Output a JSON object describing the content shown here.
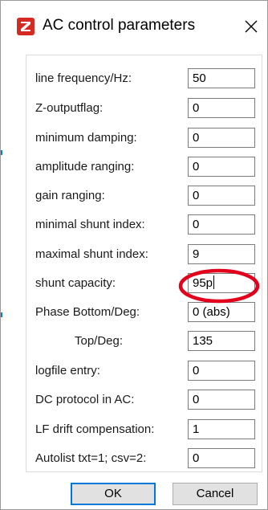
{
  "window": {
    "title": "AC control parameters",
    "accent_color": "#0078d7",
    "icon": "app-z-icon",
    "close_icon": "close-icon"
  },
  "fields": [
    {
      "label": "line frequency/Hz:",
      "value": "50"
    },
    {
      "label": "Z-outputflag:",
      "value": "0"
    },
    {
      "label": "minimum damping:",
      "value": "0"
    },
    {
      "label": "amplitude ranging:",
      "value": "0"
    },
    {
      "label": "gain ranging:",
      "value": "0"
    },
    {
      "label": "minimal shunt index:",
      "value": "0"
    },
    {
      "label": "maximal shunt index:",
      "value": "9"
    },
    {
      "label": "shunt capacity:",
      "value": "95p"
    },
    {
      "label": "Phase Bottom/Deg:",
      "value": "0 (abs)"
    },
    {
      "label": "Top/Deg:",
      "value": "135"
    },
    {
      "label": "logfile entry:",
      "value": "0"
    },
    {
      "label": "DC protocol in AC:",
      "value": "0"
    },
    {
      "label": "LF drift compensation:",
      "value": "1"
    },
    {
      "label": "Autolist txt=1; csv=2:",
      "value": "0"
    }
  ],
  "annotation": {
    "shape": "ellipse",
    "color": "#e3001b",
    "target": "shunt capacity"
  },
  "buttons": {
    "ok": "OK",
    "cancel": "Cancel"
  }
}
